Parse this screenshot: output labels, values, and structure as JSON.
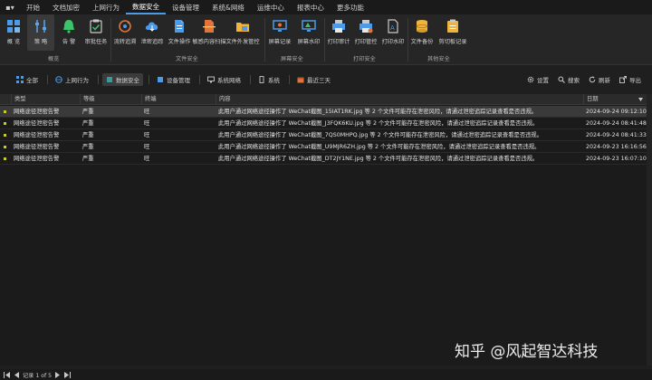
{
  "menu": {
    "app_glyph": "▪▾",
    "items": [
      "开始",
      "文档加密",
      "上网行为",
      "数据安全",
      "设备管理",
      "系统&网络",
      "运维中心",
      "报表中心",
      "更多功能"
    ]
  },
  "ribbon": {
    "buttons": [
      "概 览",
      "策 略",
      "告 警",
      "审批任务",
      "流转追溯",
      "泄密追踪",
      "文件操作",
      "敏感内容扫描",
      "文件外发管控",
      "屏幕记录",
      "屏幕水印",
      "打印审计",
      "打印管控",
      "打印水印",
      "文件备份",
      "剪切板记录"
    ],
    "groups": [
      "概览",
      "文件安全",
      "屏幕安全",
      "打印安全",
      "其他安全"
    ]
  },
  "toolbar": {
    "items": [
      "全部",
      "上网行为",
      "数据安全",
      "设备管理",
      "系统网络",
      "系统",
      "最近三天"
    ],
    "right": [
      "设置",
      "搜索",
      "刷新",
      "导出"
    ]
  },
  "grid": {
    "columns": [
      "类型",
      "等级",
      "终端",
      "内容",
      "日期"
    ],
    "rows": [
      {
        "type": "网络途径泄密告警",
        "level": "严重",
        "terminal": "旺",
        "content": "此用户通过网络途径操作了 WeChat截图_15IAT1RK.jpg 等 2 个文件可能存在泄密风险，请通过泄密追踪记录查看是否违规。",
        "date": "2024-09-24 09:12:10"
      },
      {
        "type": "网络途径泄密告警",
        "level": "严重",
        "terminal": "旺",
        "content": "此用户通过网络途径操作了 WeChat截图_J3FQK6KU.jpg 等 2 个文件可能存在泄密风险，请通过泄密追踪记录查看是否违规。",
        "date": "2024-09-24 08:41:48"
      },
      {
        "type": "网络途径泄密告警",
        "level": "严重",
        "terminal": "旺",
        "content": "此用户通过网络途径操作了 WeChat截图_7QS0MHPQ.jpg 等 2 个文件可能存在泄密风险，请通过泄密追踪记录查看是否违规。",
        "date": "2024-09-24 08:41:33"
      },
      {
        "type": "网络途径泄密告警",
        "level": "严重",
        "terminal": "旺",
        "content": "此用户通过网络途径操作了 WeChat截图_U9MJR6ZH.jpg 等 2 个文件可能存在泄密风险，请通过泄密追踪记录查看是否违规。",
        "date": "2024-09-23 16:16:56"
      },
      {
        "type": "网络途径泄密告警",
        "level": "严重",
        "terminal": "旺",
        "content": "此用户通过网络途径操作了 WeChat截图_DT2JY1NE.jpg 等 2 个文件可能存在泄密风险，请通过泄密追踪记录查看是否违规。",
        "date": "2024-09-23 16:07:10"
      }
    ]
  },
  "status": {
    "record": "记录 1 of 5"
  },
  "watermark": "知乎 @风起智达科技",
  "colors": {
    "accent": "#4c9be8",
    "selected_row": "#3a3a3a",
    "row_marker": "#c8c838",
    "background": "#1f1f1f"
  }
}
